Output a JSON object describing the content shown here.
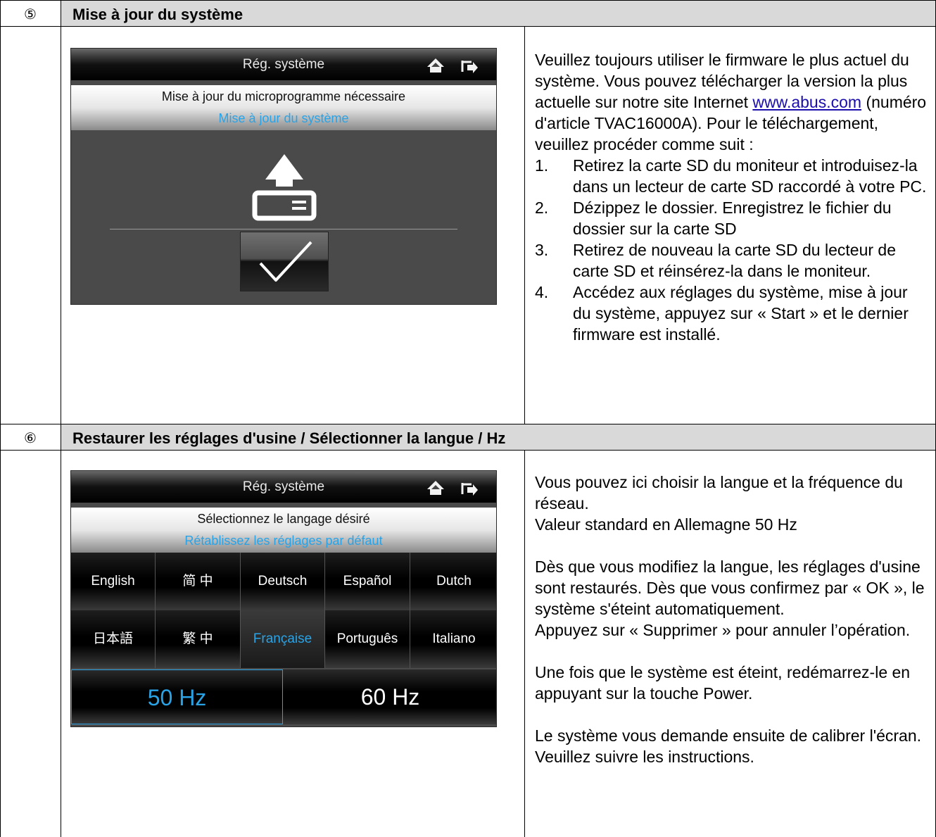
{
  "sections": [
    {
      "number": "⑤",
      "title": "Mise à jour du système",
      "screen": {
        "title": "Rég. système",
        "line1": "Mise à jour du microprogramme nécessaire",
        "line2": "Mise à jour du système",
        "icons": [
          "home-icon",
          "exit-icon",
          "upload-arrow-icon",
          "sd-card-icon",
          "checkmark-icon"
        ]
      },
      "description": {
        "p1_before_link": "Veuillez toujours utiliser le firmware le plus actuel du système. Vous pouvez télécharger la version la plus actuelle sur notre site Internet ",
        "link": "www.abus.com",
        "p1_after_link": " (numéro d'article TVAC16000A). Pour le téléchargement, veuillez procéder comme suit :",
        "steps": [
          {
            "num": "1.",
            "text": "Retirez la carte SD du moniteur et introduisez-la dans un lecteur de carte SD raccordé à votre PC."
          },
          {
            "num": "2.",
            "text": "Dézippez le dossier. Enregistrez le fichier du dossier sur la carte SD"
          },
          {
            "num": "3.",
            "text": "Retirez de nouveau la carte SD du lecteur de carte SD et réinsérez-la dans le moniteur."
          },
          {
            "num": "4.",
            "text": "Accédez aux réglages du système, mise à jour du système, appuyez sur « Start » et le dernier firmware est installé."
          }
        ]
      }
    },
    {
      "number": "⑥",
      "title": "Restaurer les réglages d'usine / Sélectionner la langue / Hz",
      "screen": {
        "title": "Rég. système",
        "line1": "Sélectionnez le langage désiré",
        "line2": "Rétablissez les réglages par défaut",
        "languages_row1": [
          "English",
          "简 中",
          "Deutsch",
          "Español",
          "Dutch"
        ],
        "languages_row2": [
          "日本語",
          "繁 中",
          "Française",
          "Português",
          "Italiano"
        ],
        "selected_language": "Française",
        "hz_options": [
          "50 Hz",
          "60 Hz"
        ],
        "selected_hz": "50 Hz"
      },
      "description": {
        "p1": "Vous pouvez ici choisir la langue et la fréquence du réseau.",
        "p2": "Valeur standard en Allemagne 50 Hz",
        "p3": "Dès que vous modifiez la langue, les réglages d'usine sont restaurés. Dès que vous confirmez par « OK », le système s'éteint automatiquement.",
        "p4": "Appuyez sur « Supprimer » pour annuler l’opération.",
        "p5": "Une fois que le système est éteint, redémarrez-le en appuyant sur la touche Power.",
        "p6": "Le système vous demande ensuite de calibrer l'écran. Veuillez suivre les instructions."
      }
    }
  ],
  "colors": {
    "header_bg": "#d9d9d9",
    "accent_blue": "#2aa3e6",
    "screen_bg": "#4a4a4a"
  }
}
